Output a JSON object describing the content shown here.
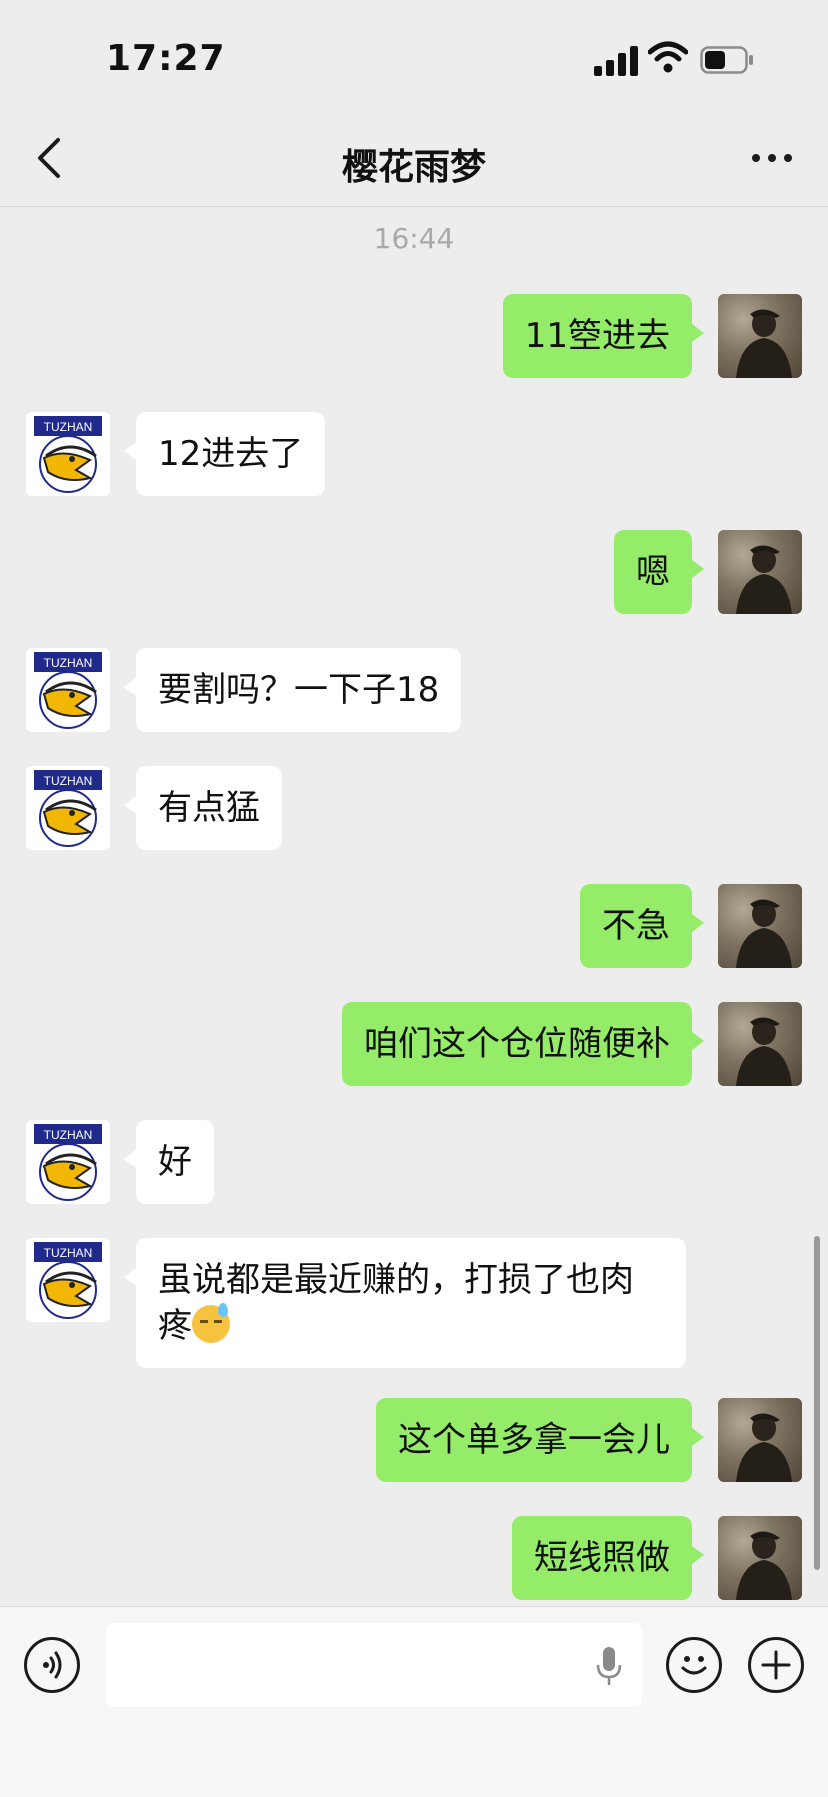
{
  "status_bar": {
    "time": "17:27"
  },
  "header": {
    "title": "樱花雨梦"
  },
  "timestamp": "16:44",
  "avatar_badge": "TUZHAN",
  "messages": [
    {
      "side": "me",
      "text": "11箜进去"
    },
    {
      "side": "them",
      "text": "12进去了"
    },
    {
      "side": "me",
      "text": "嗯"
    },
    {
      "side": "them",
      "text": "要割吗？一下子18"
    },
    {
      "side": "them",
      "text": "有点猛"
    },
    {
      "side": "me",
      "text": "不急"
    },
    {
      "side": "me",
      "text": "咱们这个仓位随便补"
    },
    {
      "side": "them",
      "text": "好"
    },
    {
      "side": "them",
      "text": "虽说都是最近赚的，打损了也肉疼",
      "emoji": "downcast-face-with-sweat"
    },
    {
      "side": "me",
      "text": "这个单多拿一会儿"
    },
    {
      "side": "me",
      "text": "短线照做"
    }
  ],
  "input": {
    "value": ""
  },
  "colors": {
    "my_bubble": "#95ec69",
    "their_bubble": "#ffffff",
    "background": "#ededed",
    "badge_blue": "#1f2a8a",
    "beak_yellow": "#f2b705"
  }
}
